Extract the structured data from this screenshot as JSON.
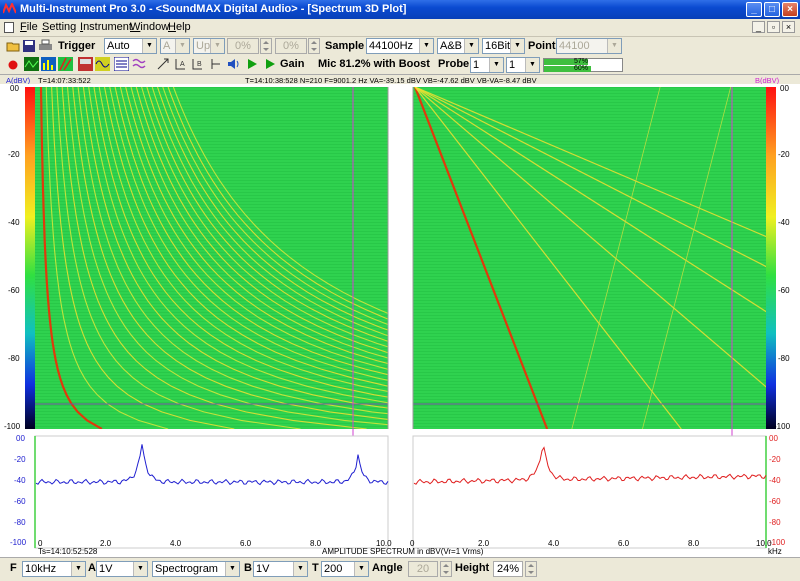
{
  "window": {
    "title": "Multi-Instrument Pro 3.0 - <SoundMAX Digital Audio> - [Spectrum 3D Plot]"
  },
  "menu": [
    {
      "first": "F",
      "rest": "ile"
    },
    {
      "first": "S",
      "rest": "etting"
    },
    {
      "first": "I",
      "rest": "nstrument"
    },
    {
      "first": "W",
      "rest": "indow"
    },
    {
      "first": "H",
      "rest": "elp"
    }
  ],
  "toolbar": {
    "trigger_label": "Trigger",
    "trigger_mode": "Auto",
    "channel": "A",
    "edge": "Up",
    "level1": "0%",
    "level2": "0%",
    "sample_label": "Sample",
    "sample_rate": "44100Hz",
    "channels": "A&B",
    "bits": "16Bit",
    "point_label": "Point",
    "points": "44100",
    "gain_label": "Gain",
    "mic_label": "Mic 81.2% with Boost",
    "probe_label": "Probe",
    "probe_a": "1",
    "probe_b": "1",
    "gain_a": "57%",
    "gain_b": "60%",
    "gain_a_level": 0.57,
    "gain_b_level": 0.6
  },
  "status": {
    "channel_a_unit": "A(dBV)",
    "channel_b_unit": "B(dBV)",
    "start_time": "T=14:07:33:522",
    "readout": "T=14:10:38:528   N=210   F=9001.2 Hz   VA=-39.15 dBV   VB=-47.62 dBV   VB-VA=-8.47 dBV",
    "bottom_time": "Ts=14:10:52:528",
    "spectrum_caption": "AMPLITUDE SPECTRUM in dBV(Vr=1 Vrms)",
    "khz_label": "kHz"
  },
  "axes": {
    "y_ticks": [
      "00",
      "-20",
      "-40",
      "-60",
      "-80",
      "-100"
    ],
    "spec_ticks": [
      "00",
      "-20",
      "-40",
      "-60",
      "-80",
      "-100"
    ],
    "x_ticks": [
      "0",
      "2.0",
      "4.0",
      "6.0",
      "8.0",
      "10.0"
    ]
  },
  "bottom": {
    "f_label": "F",
    "f_value": "10kHz",
    "a_label": "A",
    "a_value": "1V",
    "mode": "Spectrogram",
    "b_label": "B",
    "b_value": "1V",
    "t_label": "T",
    "t_value": "200",
    "angle_label": "Angle",
    "angle_value": "20",
    "height_label": "Height",
    "height_value": "24%"
  },
  "colors": {
    "channel_a": "#2020d0",
    "channel_b": "#e02020",
    "cursor": "#d040d0",
    "field": "#2fd24f"
  }
}
